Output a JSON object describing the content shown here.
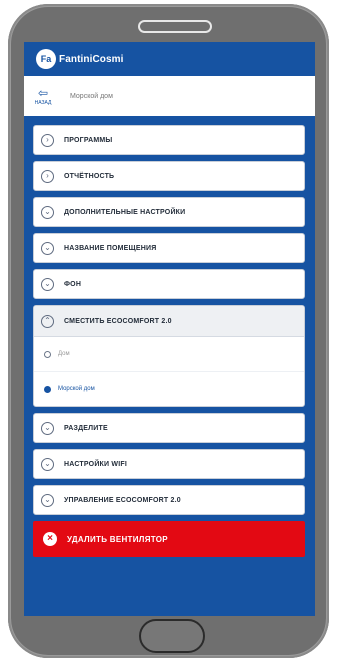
{
  "app": {
    "brand": "FantiniCosmi",
    "logo_mark": "Fa"
  },
  "nav": {
    "back_label": "НАЗАД",
    "title": "Морской дом"
  },
  "menu": [
    {
      "label": "ПРОГРАММЫ",
      "icon": "chevron-right-icon"
    },
    {
      "label": "ОТЧЁТНОСТЬ",
      "icon": "chevron-right-icon"
    },
    {
      "label": "ДОПОЛНИТЕЛЬНЫЕ НАСТРОЙКИ",
      "icon": "chevron-down-icon"
    },
    {
      "label": "НАЗВАНИЕ ПОМЕЩЕНИЯ",
      "icon": "chevron-down-icon"
    },
    {
      "label": "ФОН",
      "icon": "chevron-down-icon"
    }
  ],
  "expanded": {
    "label": "СМЕСТИТЬ ECOCOMFORT 2.0",
    "options": [
      {
        "label": "Дом",
        "selected": false
      },
      {
        "label": "Морской дом",
        "selected": true
      }
    ]
  },
  "menu_after": [
    {
      "label": "РАЗДЕЛИТЕ"
    },
    {
      "label": "НАСТРОЙКИ WIFI"
    },
    {
      "label": "УПРАВЛЕНИЕ ECOCOMFORT 2.0"
    }
  ],
  "delete_button": {
    "label": "УДАЛИТЬ ВЕНТИЛЯТОР"
  },
  "colors": {
    "brand_blue": "#1653a2",
    "danger_red": "#e30913"
  }
}
